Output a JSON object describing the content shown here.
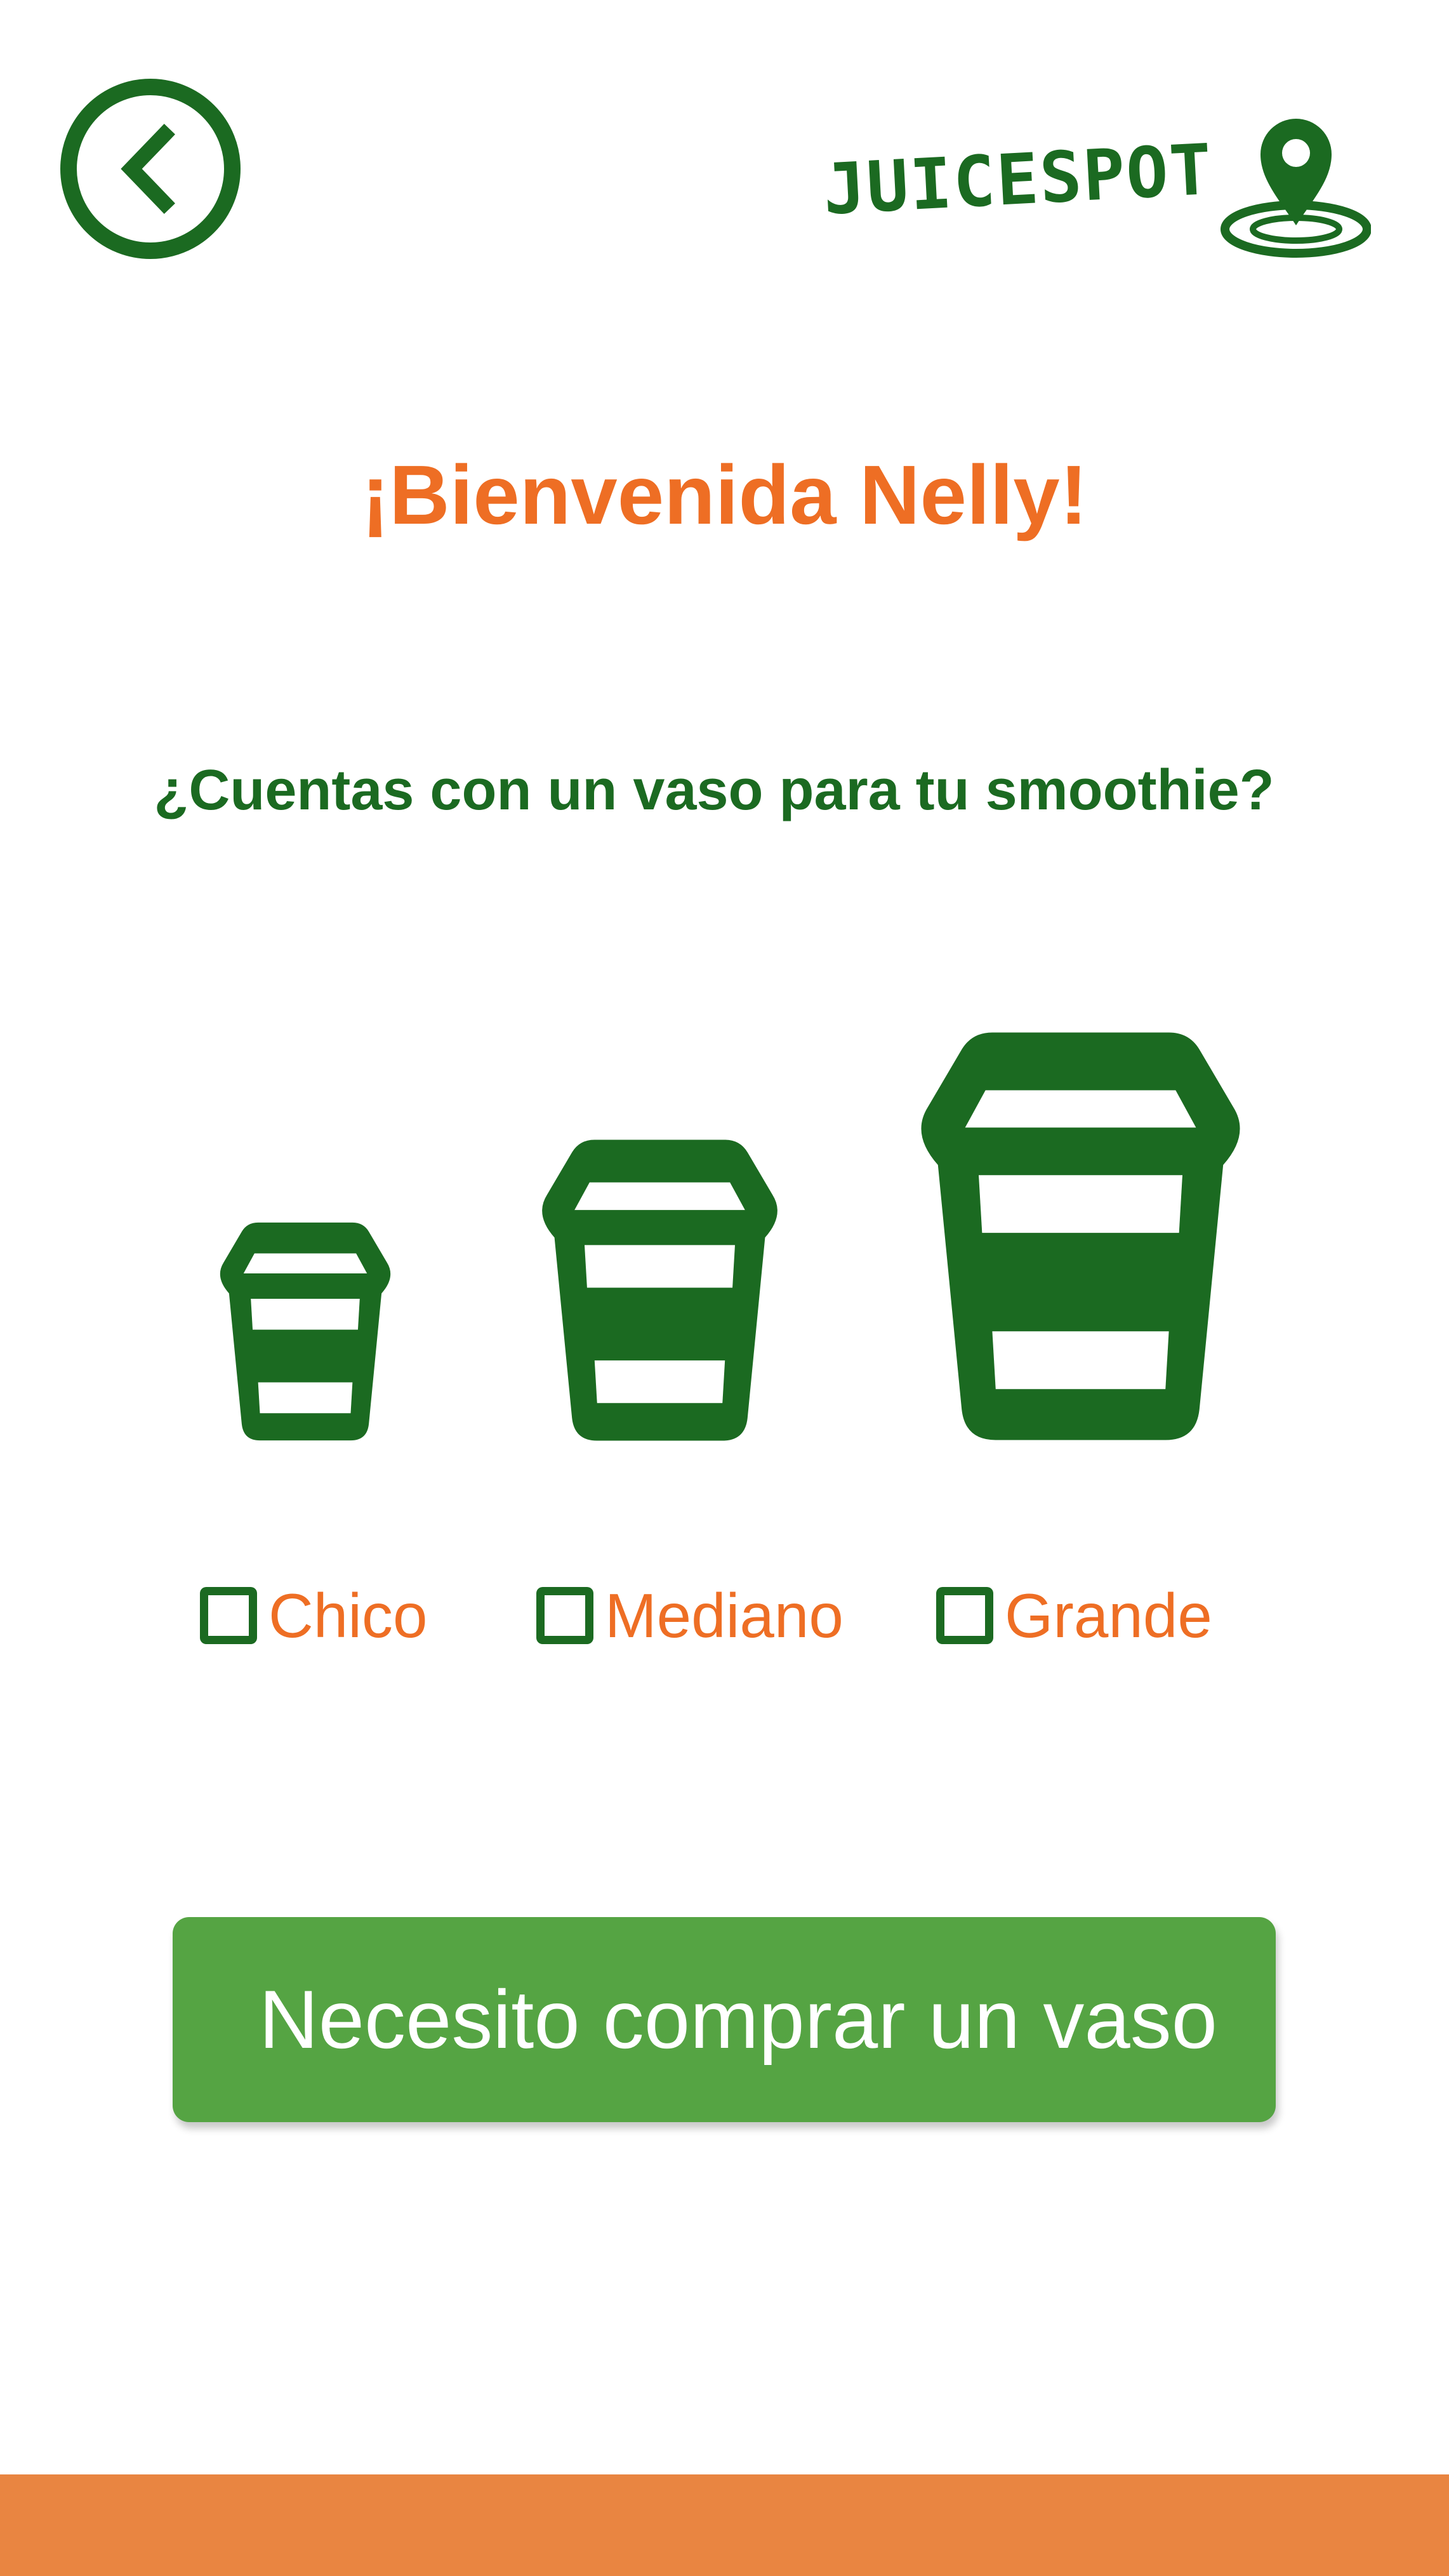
{
  "header": {
    "back_icon": "chevron-left-circle-icon",
    "logo_text": "JUICESPOT",
    "logo_icon": "map-pin-icon"
  },
  "welcome": {
    "title": "¡Bienvenida Nelly!"
  },
  "question": {
    "text": "¿Cuentas con un vaso para tu smoothie?"
  },
  "cups": [
    {
      "icon": "cup-small-icon"
    },
    {
      "icon": "cup-medium-icon"
    },
    {
      "icon": "cup-large-icon"
    }
  ],
  "options": [
    {
      "label": "Chico",
      "checked": false
    },
    {
      "label": "Mediano",
      "checked": false
    },
    {
      "label": "Grande",
      "checked": false
    }
  ],
  "buy_button": {
    "label": "Necesito comprar un vaso"
  },
  "colors": {
    "primary_green": "#1b6a21",
    "accent_orange": "#ee6e24",
    "button_green": "#55a443",
    "footer_orange": "#e98541",
    "background": "#ffffff"
  }
}
